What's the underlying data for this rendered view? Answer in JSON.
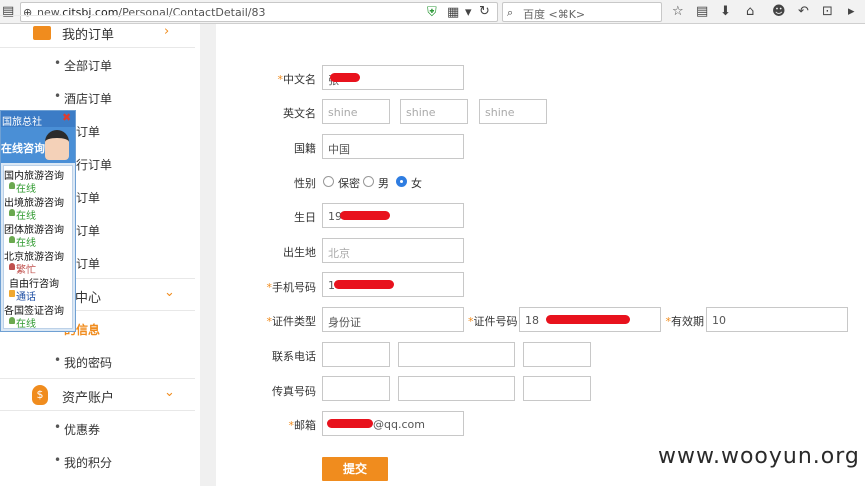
{
  "browser": {
    "url_prefix": "new.",
    "url_domain": "citsbj.com",
    "url_path": "/Personal/ContactDetail/83",
    "search_placeholder": "百度 <⌘K>"
  },
  "sidebar": {
    "orders_title": "我的订单",
    "order_items": [
      "全部订单",
      "酒店订单",
      "路订单",
      "由行订单",
      "轮订单",
      "证订单",
      "点订单"
    ],
    "personal_title": "人中心",
    "personal_items": [
      "的信息",
      "我的密码"
    ],
    "assets_title": "资产账户",
    "asset_items": [
      "优惠券",
      "我的积分"
    ]
  },
  "consult": {
    "head": "国旅总社",
    "banner": "在线咨询",
    "items": [
      {
        "name": "国内旅游咨询",
        "status": "在线"
      },
      {
        "name": "出境旅游咨询",
        "status": "在线"
      },
      {
        "name": "团体旅游咨询",
        "status": "在线"
      },
      {
        "name": "北京旅游咨询",
        "status": "繁忙"
      },
      {
        "name": "自由行咨询",
        "status": "通话"
      },
      {
        "name": "各国签证咨询",
        "status": "在线"
      }
    ]
  },
  "form": {
    "cn_name_label": "中文名",
    "cn_name_value": "张",
    "en_name_label": "英文名",
    "en_name_values": [
      "shine",
      "shine",
      "shine"
    ],
    "nationality_label": "国籍",
    "nationality_value": "中国",
    "gender_label": "性别",
    "gender_options": [
      "保密",
      "男",
      "女"
    ],
    "gender_selected": "女",
    "birthday_label": "生日",
    "birthday_value": "198",
    "birthplace_label": "出生地",
    "birthplace_value": "北京",
    "mobile_label": "手机号码",
    "mobile_value": "1",
    "id_type_label": "证件类型",
    "id_type_value": "身份证",
    "id_no_label": "证件号码",
    "id_no_value": "18",
    "valid_label": "有效期",
    "valid_value": "10",
    "phone_label": "联系电话",
    "fax_label": "传真号码",
    "email_label": "邮箱",
    "email_value": "@qq.com",
    "submit_label": "提交"
  },
  "watermark": "www.wooyun.org",
  "colors": {
    "accent": "#f08c1e",
    "redaction": "#e8121d",
    "radio_selected": "#2f7de1"
  }
}
